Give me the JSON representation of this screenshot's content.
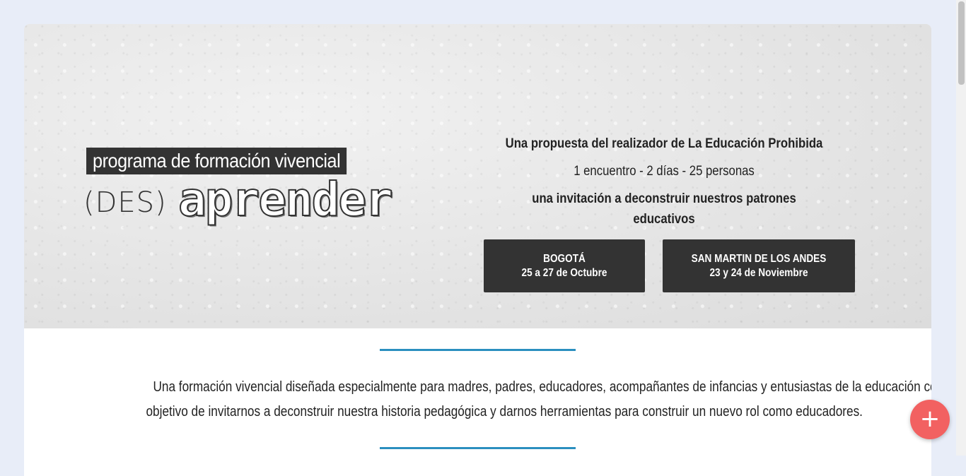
{
  "hero": {
    "tagline": "programa de formación vivencial",
    "logo_prefix": "(DES)",
    "logo_word": "aprender",
    "intro_line_1": "Una propuesta del realizador de La Educación Prohibida",
    "intro_line_2": "1 encuentro - 2 días - 25 personas",
    "intro_line_3": "una invitación a deconstruir nuestros patrones educativos",
    "locations": [
      {
        "city": "BOGOTÁ",
        "dates": "25 a 27 de Octubre"
      },
      {
        "city": "SAN MARTIN DE LOS ANDES",
        "dates": "23 y 24 de Noviembre"
      }
    ]
  },
  "description": {
    "line_1": "Una formación vivencial diseñada especialmente para madres, padres, educadores, acompañantes de infancias y entusiastas de la educación con el",
    "line_2": "objetivo de invitarnos a deconstruir nuestra historia pedagógica y darnos herramientas para construir un nuevo rol como educadores."
  },
  "fab": {
    "icon": "plus-icon",
    "symbol": "+"
  },
  "colors": {
    "page_bg": "#e8edf8",
    "dark": "#333333",
    "accent_line": "#2b8fbf",
    "fab": "#f26161"
  }
}
